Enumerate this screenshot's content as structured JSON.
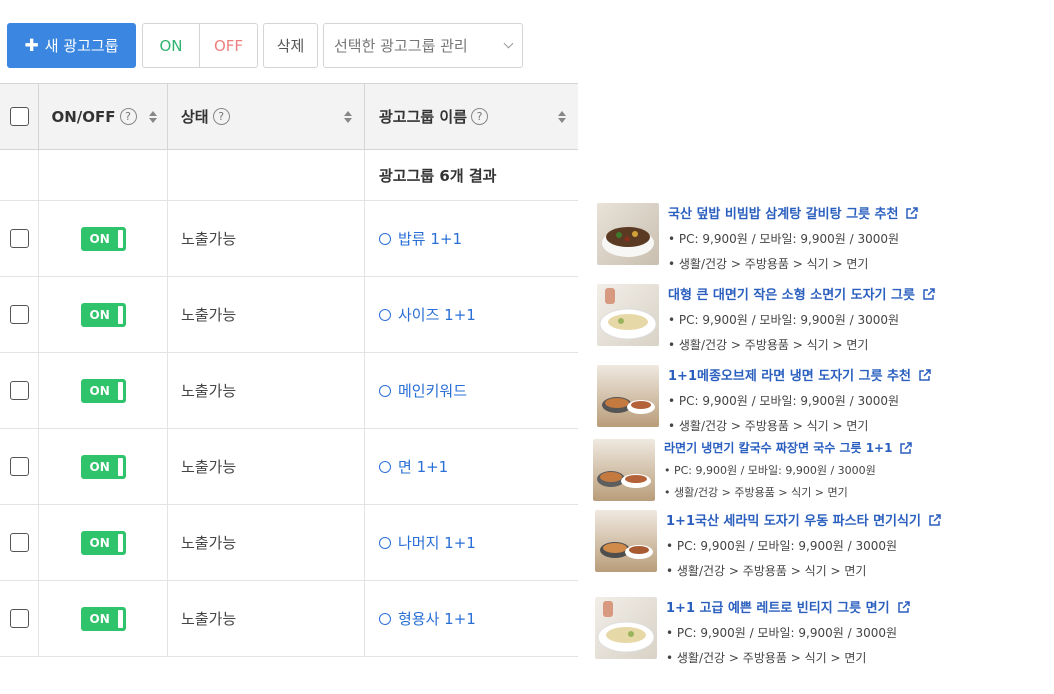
{
  "toolbar": {
    "new_group": "새 광고그룹",
    "on": "ON",
    "off": "OFF",
    "delete": "삭제",
    "manage_selected": "선택한 광고그룹 관리"
  },
  "table": {
    "headers": {
      "onoff": "ON/OFF",
      "status": "상태",
      "name": "광고그룹 이름",
      "help": "?"
    },
    "summary": "광고그룹 6개 결과",
    "rows": [
      {
        "toggle": "ON",
        "status": "노출가능",
        "name": "밥류 1+1"
      },
      {
        "toggle": "ON",
        "status": "노출가능",
        "name": "사이즈 1+1"
      },
      {
        "toggle": "ON",
        "status": "노출가능",
        "name": "메인키워드"
      },
      {
        "toggle": "ON",
        "status": "노출가능",
        "name": "면 1+1"
      },
      {
        "toggle": "ON",
        "status": "노출가능",
        "name": "나머지 1+1"
      },
      {
        "toggle": "ON",
        "status": "노출가능",
        "name": "형용사 1+1"
      }
    ]
  },
  "products": [
    {
      "title": "국산 덮밥 비빔밥 삼계탕 갈비탕 그릇 추천",
      "price": "• PC: 9,900원 /  모바일: 9,900원 /  3000원",
      "category": "• 생활/건강 > 주방용품 > 식기 > 면기"
    },
    {
      "title": "대형 큰 대면기 작은 소형 소면기 도자기 그릇",
      "price": "• PC: 9,900원 /  모바일: 9,900원 /  3000원",
      "category": "• 생활/건강 > 주방용품 > 식기 > 면기"
    },
    {
      "title": "1+1메종오브제 라면 냉면 도자기 그릇 추천",
      "price": "• PC: 9,900원 /  모바일: 9,900원 /  3000원",
      "category": "• 생활/건강 > 주방용품 > 식기 > 면기"
    },
    {
      "title": "라면기 냉면기 칼국수 짜장면 국수 그릇 1+1",
      "price": "• PC: 9,900원 /  모바일: 9,900원 /  3000원",
      "category": "• 생활/건강 > 주방용품 > 식기 > 면기"
    },
    {
      "title": "1+1국산 세라믹 도자기 우동 파스타 면기식기",
      "price": "• PC: 9,900원 /  모바일: 9,900원 /  3000원",
      "category": "• 생활/건강 > 주방용품 > 식기 > 면기"
    },
    {
      "title": "1+1 고급 예쁜 레트로 빈티지 그릇 면기",
      "price": "• PC: 9,900원 /  모바일: 9,900원 /  3000원",
      "category": "• 생활/건강 > 주방용품 > 식기 > 면기"
    }
  ],
  "colors": {
    "primary": "#3a86e0",
    "on": "#2fc36b",
    "off": "#ee7f7f",
    "link": "#2a6fd6"
  }
}
